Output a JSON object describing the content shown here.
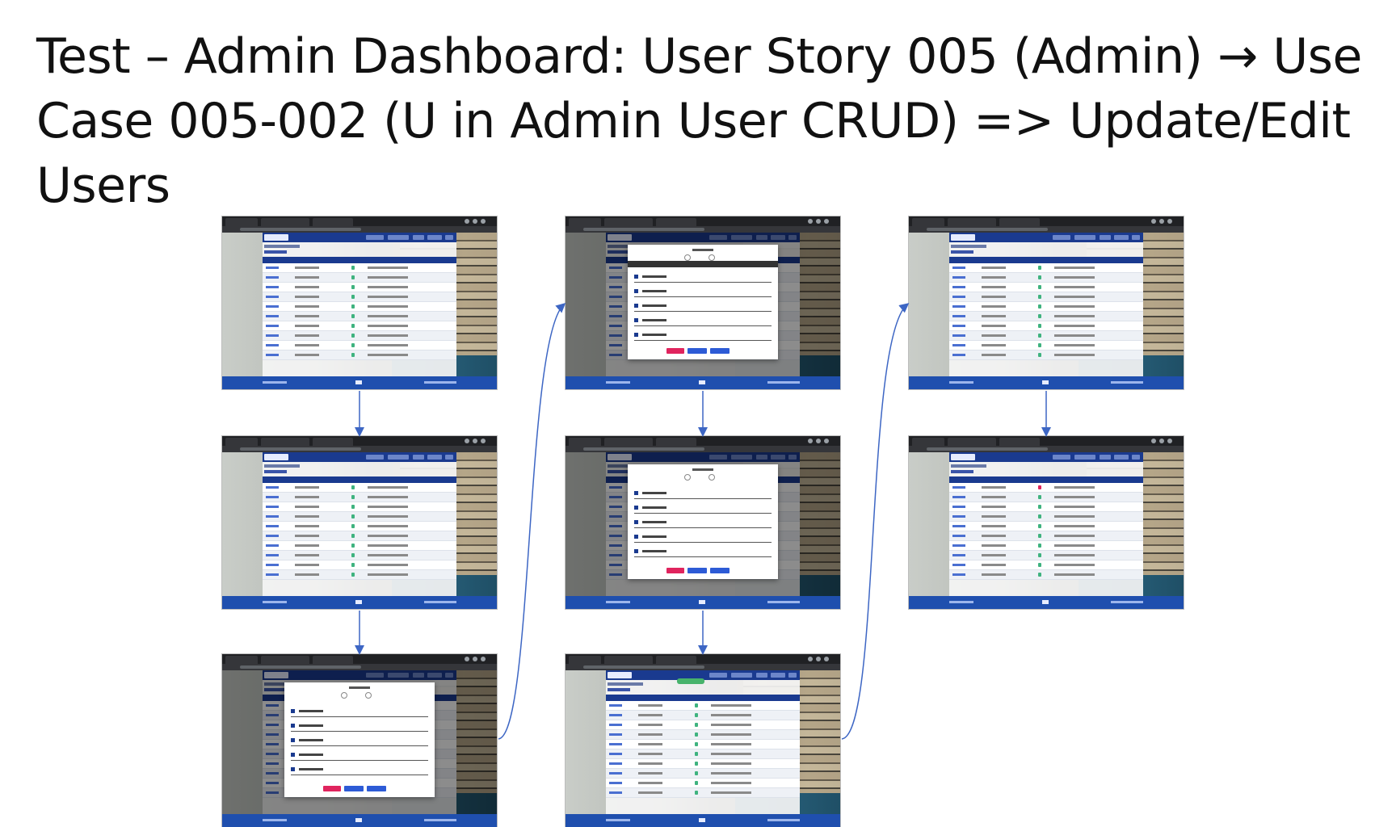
{
  "slide": {
    "title_bold": "Test – Admin Dashboard:",
    "title_rest": " User Story 005 (Admin) ",
    "arrow_glyph": "→",
    "title_tail": " Use Case 005-002 (U in Admin User CRUD) => Update/Edit Users"
  },
  "screenshots": [
    {
      "id": "s1",
      "kind": "list",
      "rows": 10
    },
    {
      "id": "s2",
      "kind": "list",
      "rows": 10
    },
    {
      "id": "s3",
      "kind": "modal",
      "rows": 10
    },
    {
      "id": "s4",
      "kind": "modal-warning",
      "rows": 10
    },
    {
      "id": "s5",
      "kind": "modal",
      "rows": 10
    },
    {
      "id": "s6",
      "kind": "list-success",
      "rows": 10
    },
    {
      "id": "s7",
      "kind": "list",
      "rows": 10
    },
    {
      "id": "s8",
      "kind": "list",
      "rows": 10
    }
  ],
  "colors": {
    "navy": "#1a3a8f",
    "footer_blue": "#1f4fae",
    "connector": "#3d66c4",
    "delete_red": "#e0245e",
    "update_blue": "#2d5bd6",
    "success_green": "#47b36b"
  }
}
